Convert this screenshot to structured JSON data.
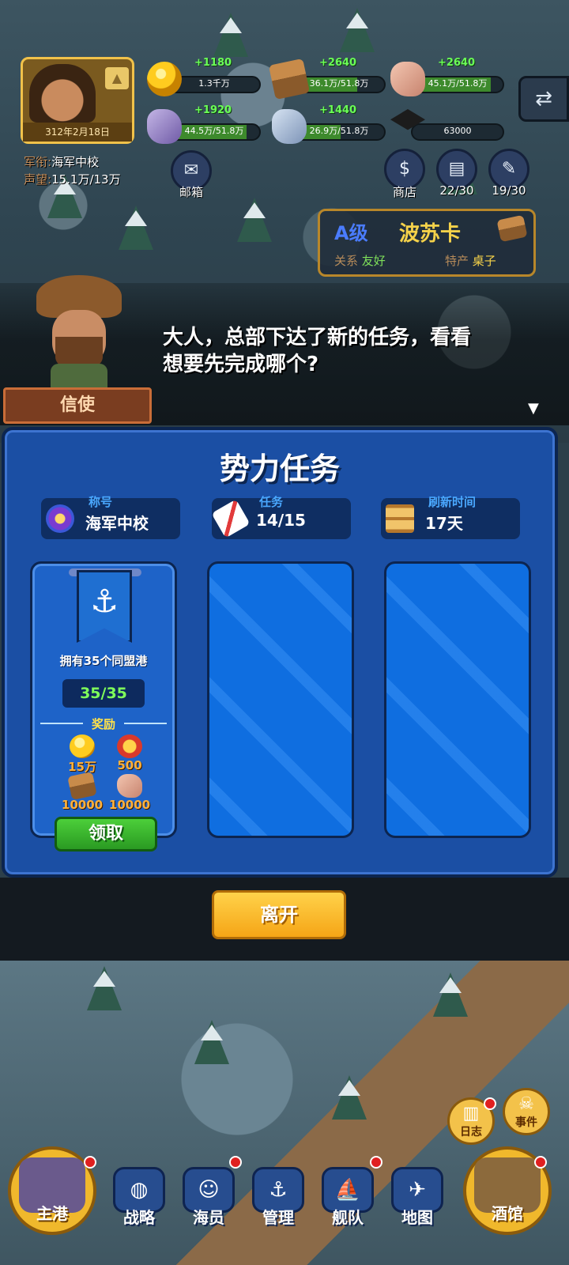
{
  "hud": {
    "date": "312年2月18日",
    "rank_label": "军衔:",
    "rank_value": "海军中校",
    "fame_label": "声望:",
    "fame_value": "15.1万/13万",
    "resources": [
      {
        "name": "gold",
        "gain": "+1180",
        "value": "1.3千万",
        "fill_fraction": 0.0
      },
      {
        "name": "wood",
        "gain": "+2640",
        "value": "36.1万/51.8万",
        "fill_fraction": 0.7
      },
      {
        "name": "stone",
        "gain": "+2640",
        "value": "45.1万/51.8万",
        "fill_fraction": 0.87
      },
      {
        "name": "crystal",
        "gain": "+1920",
        "value": "44.5万/51.8万",
        "fill_fraction": 0.86
      },
      {
        "name": "ice-ore",
        "gain": "+1440",
        "value": "26.9万/51.8万",
        "fill_fraction": 0.52
      },
      {
        "name": "education",
        "gain": "",
        "value": "63000",
        "fill_fraction": 0.0
      }
    ],
    "mail_label": "邮箱",
    "shop_label": "商店",
    "book_label": "22/30",
    "quest_label": "19/30",
    "switch_icon": "swap-arrows-icon"
  },
  "city_card": {
    "grade": "A级",
    "name": "波苏卡",
    "relation_label": "关系",
    "relation_value": "友好",
    "product_label": "特产",
    "product_value": "桌子"
  },
  "dialog": {
    "speaker": "信使",
    "text_line1": "大人，总部下达了新的任务，看看",
    "text_line2": "想要先完成哪个?",
    "more_icon": "▼"
  },
  "panel": {
    "title": "势力任务",
    "stats": [
      {
        "caption": "称号",
        "value": "海军中校"
      },
      {
        "caption": "任务",
        "value": "14/15"
      },
      {
        "caption": "刷新时间",
        "value": "17天"
      }
    ],
    "task": {
      "description": "拥有35个同盟港",
      "progress": "35/35",
      "reward_label": "奖励",
      "rewards": [
        {
          "icon": "gold-coin-icon",
          "value": "15万"
        },
        {
          "icon": "star-medal-icon",
          "value": "500"
        },
        {
          "icon": "wood-plank-icon",
          "value": "10000"
        },
        {
          "icon": "stone-icon",
          "value": "10000"
        }
      ],
      "claim_label": "领取"
    },
    "leave_label": "离开"
  },
  "nav": {
    "home": "主港",
    "strategy": "战略",
    "crew": "海员",
    "manage": "管理",
    "fleet": "舰队",
    "map": "地图",
    "tavern": "酒馆",
    "log": "日志",
    "events": "事件"
  },
  "colors": {
    "panel_blue": "#1b4fa4",
    "progress_green": "#7fff5a",
    "reward_orange": "#ffb13b",
    "claim_green": "#2a9a22",
    "leave_yellow": "#f5a516"
  }
}
